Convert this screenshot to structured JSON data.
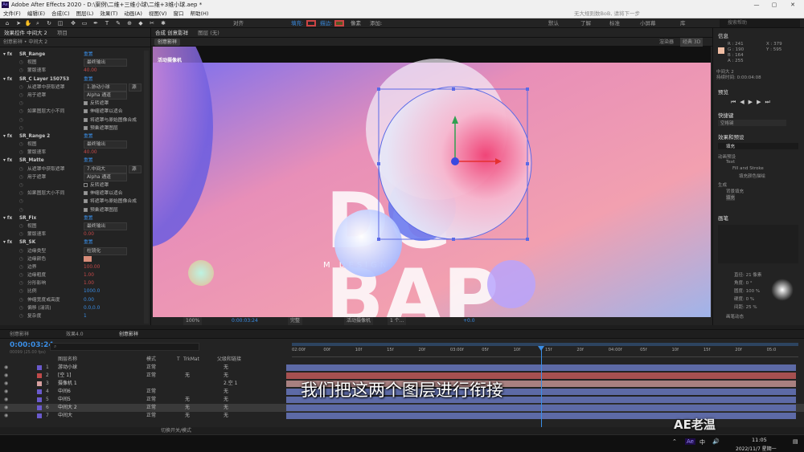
{
  "window": {
    "title": "Adobe After Effects 2020 - D:\\案例\\二维+三维小球\\二维+3维小球.aep *",
    "controls": [
      "—",
      "▢",
      "✕"
    ]
  },
  "menu": {
    "items": [
      "文件(F)",
      "编辑(E)",
      "合成(C)",
      "图层(L)",
      "效果(T)",
      "动画(A)",
      "视图(V)",
      "窗口",
      "帮助(H)"
    ],
    "right_text": "无大规则数BoB, 请将下一步"
  },
  "toolbar": {
    "align_label": "对齐",
    "fill_label": "填充:",
    "stroke_label": "描边:",
    "stroke_value": "像素",
    "add_label": "添加:",
    "workspaces": [
      "默认",
      "了解",
      "标准",
      "小屏幕",
      "库"
    ],
    "search_placeholder": "搜索帮助"
  },
  "left": {
    "tabs": [
      "效果控件 中间大 2",
      "项目"
    ],
    "breadcrumb": "创意影祥 • 中间大 2",
    "effect_rows": [
      {
        "kind": "fx",
        "name": "SR_Range",
        "value": "重置"
      },
      {
        "kind": "prop",
        "name": "视图",
        "value": "最终输出",
        "dd": true
      },
      {
        "kind": "prop",
        "name": "蒙版速率",
        "value": "40.00",
        "red": true
      },
      {
        "kind": "fx",
        "name": "SR_C Layer 150753",
        "value": "重置"
      },
      {
        "kind": "prop",
        "name": "从遮罩中获取遮罩",
        "value": "1.游动小球",
        "dd": true,
        "extra": "源"
      },
      {
        "kind": "prop",
        "name": "用于遮罩",
        "value": "Alpha 通道",
        "dd": true
      },
      {
        "kind": "check",
        "name": "",
        "value": "反转遮罩",
        "on": true
      },
      {
        "kind": "check",
        "name": "如果图层大小不同",
        "value": "伸缩遮罩以适合",
        "on": true
      },
      {
        "kind": "check",
        "name": "",
        "value": "将遮罩与原始图像合成",
        "on": true
      },
      {
        "kind": "check",
        "name": "",
        "value": "预乘遮罩图层",
        "on": true
      },
      {
        "kind": "fx",
        "name": "SR_Range 2",
        "value": "重置"
      },
      {
        "kind": "prop",
        "name": "视图",
        "value": "最终输出",
        "dd": true
      },
      {
        "kind": "prop",
        "name": "蒙版速率",
        "value": "40.00",
        "red": true
      },
      {
        "kind": "fx",
        "name": "SR_Matte",
        "value": "重置"
      },
      {
        "kind": "prop",
        "name": "从遮罩中获取遮罩",
        "value": "7.中间大",
        "dd": true,
        "extra": "源"
      },
      {
        "kind": "prop",
        "name": "用于遮罩",
        "value": "Alpha 通道",
        "dd": true
      },
      {
        "kind": "check",
        "name": "",
        "value": "反转遮罩",
        "on": false
      },
      {
        "kind": "check",
        "name": "如果图层大小不同",
        "value": "伸缩遮罩以适合",
        "on": true
      },
      {
        "kind": "check",
        "name": "",
        "value": "将遮罩与原始图像合成",
        "on": true
      },
      {
        "kind": "check",
        "name": "",
        "value": "预乘遮罩图层",
        "on": true
      },
      {
        "kind": "fx",
        "name": "SR_Fix",
        "value": "重置"
      },
      {
        "kind": "prop",
        "name": "视图",
        "value": "最终输出",
        "dd": true
      },
      {
        "kind": "prop",
        "name": "蒙版速率",
        "value": "0.00",
        "red": true
      },
      {
        "kind": "fx",
        "name": "SR_SK",
        "value": "重置"
      },
      {
        "kind": "prop",
        "name": "边缘类型",
        "value": "柱镜化",
        "dd": true
      },
      {
        "kind": "prop",
        "name": "边缘颜色",
        "value": "",
        "swatch": true
      },
      {
        "kind": "prop",
        "name": "边界",
        "value": "100.00",
        "red": true
      },
      {
        "kind": "prop",
        "name": "边缘粗度",
        "value": "1.00",
        "red": true
      },
      {
        "kind": "prop",
        "name": "分形影响",
        "value": "1.00",
        "red": true
      },
      {
        "kind": "prop",
        "name": "比例",
        "value": "1000.0",
        "blue": true
      },
      {
        "kind": "prop",
        "name": "伸缩宽度或高度",
        "value": "0.00",
        "blue": true
      },
      {
        "kind": "prop",
        "name": "偏移 (湍流)",
        "value": "0.0,0.0",
        "blue": true
      },
      {
        "kind": "prop",
        "name": "复杂度",
        "value": "1",
        "blue": true
      }
    ]
  },
  "comp": {
    "tab_label": "合成 创意影祥",
    "layer_tab": "图层 (无)",
    "crumb": "创意影祥",
    "renderer_label": "渲染器",
    "renderer_value": "经典 3D",
    "camera_label": "活动摄像机",
    "zoom": "100%",
    "timecode": "0:00:03:24",
    "resolution": "完整",
    "camera_select": "活动摄像机",
    "views": "1 个...",
    "exposure": "+0.0",
    "canvas_text": {
      "design": "M   DESIGN"
    }
  },
  "right": {
    "info": {
      "title": "信息",
      "r": "R : 241",
      "g": "G : 190",
      "b": "B : 164",
      "a": "A : 255",
      "x": "X : 379",
      "y": "Y : 595",
      "layer": "中间大 2",
      "duration": "持续时间: 0:00:04:08"
    },
    "preview": {
      "title": "预览"
    },
    "shortcut": {
      "title": "快捷键",
      "value": "空格键"
    },
    "effects": {
      "title": "效果和预设",
      "search": "填充",
      "tree": [
        "动画预设",
        "Text",
        "Fill and Stroke",
        "填充颜色描绘",
        "生成",
        "背景填充",
        "填充"
      ]
    },
    "brushes": {
      "title": "画笔",
      "diameter": "直径: 21 像素",
      "angle": "角度: 0 °",
      "roundness": "圆度: 100 %",
      "hardness": "硬度: 0 %",
      "spacing": "间距: 25 %",
      "dynamics": "画笔动态"
    }
  },
  "timeline": {
    "tabs": [
      "创意影祥",
      "效果4.0",
      "创意影祥"
    ],
    "timecode": "0:00:03:24",
    "timecode_sub": "00099 (25.00 fps)",
    "columns": {
      "layer_name": "图层名称",
      "mode": "模式",
      "t": "T",
      "trkmat": "TrkMat",
      "parent": "父级和链接"
    },
    "ruler": [
      "02:00f",
      "00f",
      "10f",
      "15f",
      "20f",
      "03:00f",
      "05f",
      "10f",
      "15f",
      "20f",
      "04:00f",
      "05f",
      "10f",
      "15f",
      "20f",
      "05:0"
    ],
    "layers": [
      {
        "num": "1",
        "name": "游动小球",
        "mode": "正常",
        "trk": "",
        "parent": "无",
        "color": "#6a5acd",
        "bar": "#5d6aa6"
      },
      {
        "num": "2",
        "name": "[空 1]",
        "mode": "正常",
        "trk": "无",
        "parent": "无",
        "color": "#c04a4a",
        "bar": "#a65050"
      },
      {
        "num": "3",
        "name": "摄像机 1",
        "mode": "",
        "trk": "",
        "parent": "2.空 1",
        "color": "#d8a0a0",
        "bar": "#a88080"
      },
      {
        "num": "4",
        "name": "中间6",
        "mode": "正常",
        "trk": "",
        "parent": "无",
        "color": "#6a5acd",
        "bar": "#5d6aa6"
      },
      {
        "num": "5",
        "name": "中间5",
        "mode": "正常",
        "trk": "无",
        "parent": "无",
        "color": "#6a5acd",
        "bar": "#5d6aa6"
      },
      {
        "num": "6",
        "name": "中间大 2",
        "mode": "正常",
        "trk": "无",
        "parent": "无",
        "color": "#6a5acd",
        "bar": "#5d6aa6",
        "sel": true
      },
      {
        "num": "7",
        "name": "中间大",
        "mode": "正常",
        "trk": "无",
        "parent": "无",
        "color": "#6a5acd",
        "bar": "#5d6aa6"
      }
    ],
    "footer": "切换开关/模式"
  },
  "subtitle": "我们把这两个图层进行衔接",
  "watermark": "AE老温",
  "taskbar": {
    "time": "11:05",
    "date": "2022/11/7 星期一",
    "ime": "中",
    "vol": "🔊"
  },
  "colors": {
    "accent": "#3a8ee6",
    "panel": "#232323",
    "selection": "#3a3a3a"
  }
}
